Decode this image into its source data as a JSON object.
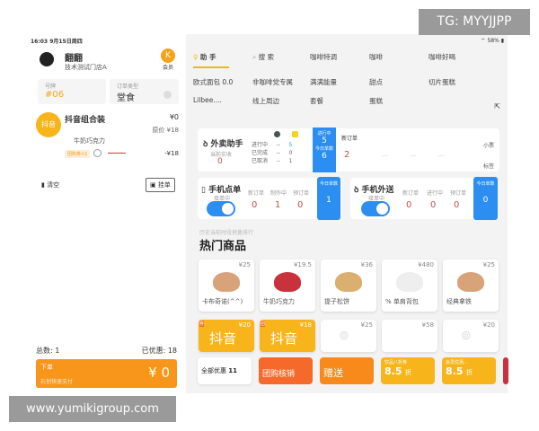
{
  "overlay": {
    "tg": "TG: MYYJJPP",
    "site": "www.yumikigroup.com"
  },
  "status": {
    "time": "16:03",
    "date": "9月15日周四",
    "battery": "58%"
  },
  "header": {
    "user": "翻翻",
    "store": "技术测试门店A",
    "member": "会员"
  },
  "order": {
    "number_label": "号牌",
    "number": "#06",
    "type_label": "订单类型",
    "type": "堂食"
  },
  "cart": {
    "item_badge": "抖音",
    "item_name": "抖音组合装",
    "item_price": "¥0",
    "orig_label": "原价",
    "orig_price": "¥18",
    "sub_item": "牛奶巧克力",
    "coupon_tag": "团购券×1",
    "discount": "-¥18",
    "clear": "清空",
    "hold": "挂单"
  },
  "summary": {
    "total_label": "总数: 1",
    "discount_label": "已优惠: 18",
    "submit": "下单",
    "submit_sub": "右划快速支付",
    "amount": "¥ 0"
  },
  "categories": [
    [
      "助 手",
      "搜 索",
      "咖啡特调",
      "咖啡",
      "咖啡好喝"
    ],
    [
      "欧式面包 0.0",
      "非咖啡党专属",
      "满满能量",
      "甜点",
      "切片蛋糕"
    ],
    [
      "Lilbee....",
      "线上周边",
      "套餐",
      "蛋糕",
      ""
    ]
  ],
  "delivery": {
    "title": "外卖助手",
    "received_label": "当前实收",
    "received": "0",
    "rows": [
      {
        "label": "进行中",
        "a": "--",
        "b": "5"
      },
      {
        "label": "已完成",
        "a": "--",
        "b": "0"
      },
      {
        "label": "已取消",
        "a": "--",
        "b": "1"
      }
    ],
    "inprogress_label": "进行中",
    "inprogress": "5",
    "today_label": "今日单数",
    "today": "6",
    "new_label": "新订单",
    "new": "2",
    "dash": "—",
    "receipt": "小票",
    "tag": "标签"
  },
  "mobile_order": {
    "title": "手机点单",
    "accept": "接单中",
    "cols": [
      {
        "label": "新订单",
        "v": "0"
      },
      {
        "label": "制作中",
        "v": "1"
      },
      {
        "label": "预订单",
        "v": "0"
      }
    ],
    "today_label": "今日单数",
    "today": "1"
  },
  "mobile_delivery": {
    "title": "手机外送",
    "accept": "接单中",
    "cols": [
      {
        "label": "新订单",
        "v": "0"
      },
      {
        "label": "进行中",
        "v": "0"
      },
      {
        "label": "预订单",
        "v": "0"
      }
    ],
    "today_label": "今日单数",
    "today": "0"
  },
  "hot": {
    "subtitle": "历史当前时段销量排行",
    "title": "热门商品"
  },
  "products": [
    {
      "name": "卡布奇诺(^^)",
      "price": "¥25"
    },
    {
      "name": "牛奶巧克力",
      "price": "¥19.5"
    },
    {
      "name": "提子松饼",
      "price": "¥36"
    },
    {
      "name": "% 单肩背包",
      "price": "¥480"
    },
    {
      "name": "经典拿铁",
      "price": "¥25"
    }
  ],
  "products2": [
    {
      "badge": "券",
      "label": "抖音",
      "price": "¥20"
    },
    {
      "badge": "团",
      "label": "抖音",
      "price": "¥18"
    },
    {
      "price": "¥25"
    },
    {
      "price": "¥58"
    },
    {
      "price": "¥20"
    }
  ],
  "coupons": {
    "all": "全部优惠",
    "count": "11",
    "group": "团购核销",
    "gift": "赠送",
    "c1_label": "饮品八折券",
    "c1": "8.5",
    "c2_label": "会员优惠...",
    "c2": "8.5",
    "zhe": "折"
  },
  "colors": {
    "accent": "#f7a21b",
    "blue": "#2b8ef0",
    "orange": "#f56a2a"
  }
}
